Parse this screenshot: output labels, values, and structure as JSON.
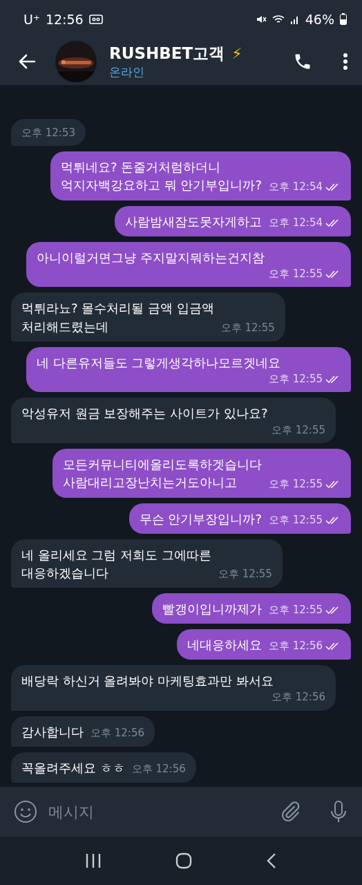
{
  "status_bar": {
    "carrier": "U⁺",
    "time": "12:56",
    "battery": "46%"
  },
  "header": {
    "title": "RUSHBET고객",
    "emoji": "⚡",
    "status": "온라인"
  },
  "messages": [
    {
      "kind": "incoming",
      "time": "오후 12:53"
    },
    {
      "kind": "outgoing",
      "text": "먹튀네요? 돈줄거처럼하더니\n억지자백강요하고 뭐 안기부입니까?",
      "time": "오후 12:54",
      "read": true
    },
    {
      "kind": "outgoing",
      "text": "사람밤새잠도못자게하고",
      "time": "오후 12:54",
      "read": true
    },
    {
      "kind": "outgoing",
      "text": "아니이럴거면그냥 주지말지뭐하는건지참",
      "time": "오후 12:55",
      "read": true
    },
    {
      "kind": "incoming",
      "text": "먹튀라뇨? 몰수처리될 금액 입금액\n처리해드렸는데",
      "time": "오후 12:55"
    },
    {
      "kind": "outgoing",
      "text": "네 다른유저들도 그렇게생각하나모르겟네요",
      "time": "오후 12:55",
      "read": true
    },
    {
      "kind": "incoming",
      "text": "악성유저 원금 보장해주는 사이트가 있나요?",
      "time": "오후 12:55"
    },
    {
      "kind": "outgoing",
      "text": "모든커뮤니티에올리도록하겟습니다\n사람대리고장난치는거도아니고",
      "time": "오후 12:55",
      "read": true
    },
    {
      "kind": "outgoing",
      "text": "무슨 안기부장입니까?",
      "time": "오후 12:55",
      "read": true
    },
    {
      "kind": "incoming",
      "text": "네 올리세요 그럼 저희도 그에따른\n대응하겠습니다",
      "time": "오후 12:55"
    },
    {
      "kind": "outgoing",
      "text": "빨갱이입니까제가",
      "time": "오후 12:55",
      "read": true
    },
    {
      "kind": "outgoing",
      "text": "네대응하세요",
      "time": "오후 12:56",
      "read": true
    },
    {
      "kind": "incoming",
      "text": "배당락 하신거 올려봐야 마케팅효과만 봐서요",
      "time": "오후 12:56"
    },
    {
      "kind": "incoming",
      "text": "감사합니다",
      "time": "오후 12:56"
    },
    {
      "kind": "incoming",
      "text": "꼭올려주세요 ㅎㅎ",
      "time": "오후 12:56"
    }
  ],
  "composer": {
    "placeholder": "메시지"
  }
}
